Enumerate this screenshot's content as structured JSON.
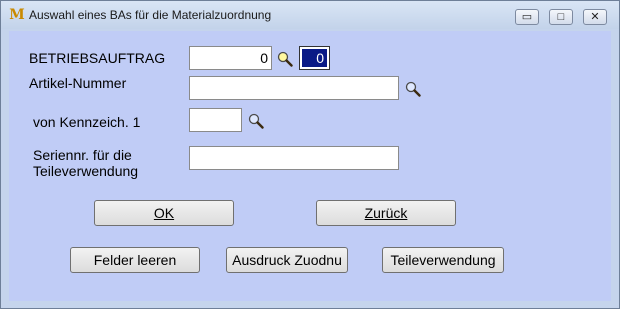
{
  "window": {
    "title": "Auswahl eines BAs für die Materialzuordnung",
    "app_icon": "M",
    "controls": {
      "minimize": "▭",
      "maximize": "□",
      "close": "✕"
    }
  },
  "form": {
    "betriebsauftrag": {
      "label": "BETRIEBSAUFTRAG",
      "value": "0",
      "selected_value": "0"
    },
    "artikel": {
      "label": "Artikel-Nummer",
      "value": ""
    },
    "kennzeichen": {
      "label": "von  Kennzeich. 1",
      "value": ""
    },
    "seriennr": {
      "label_line1": "Seriennr. für die",
      "label_line2": "Teileverwendung",
      "value": ""
    }
  },
  "buttons": {
    "ok": "OK",
    "zurueck": "Zurück",
    "felder_leeren": "Felder leeren",
    "ausdruck": "Ausdruck  Zuodnu",
    "teileverwendung": "Teileverwendung"
  },
  "colors": {
    "client_bg": "#c0ccf6",
    "selected_bg": "#0a1a86"
  }
}
